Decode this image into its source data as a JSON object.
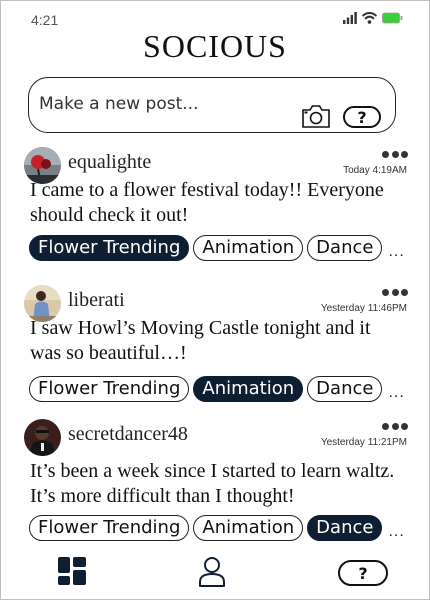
{
  "status_bar": {
    "time": "4:21"
  },
  "app": {
    "title": "SOCIOUS"
  },
  "composer": {
    "placeholder": "Make a new post...",
    "help_label": "?"
  },
  "posts": [
    {
      "username": "equalighte",
      "timestamp": "Today 4:19AM",
      "text": "I came to a flower festival today!! Everyone should check it out!",
      "tags": [
        "Flower Trending",
        "Animation",
        "Dance"
      ],
      "active_tag": "Flower Trending",
      "more": "..."
    },
    {
      "username": "liberati",
      "timestamp": "Yesterday 11:46PM",
      "text": "I saw Howl’s Moving Castle tonight and it was so beautiful…!",
      "tags": [
        "Flower Trending",
        "Animation",
        "Dance"
      ],
      "active_tag": "Animation",
      "more": "..."
    },
    {
      "username": "secretdancer48",
      "timestamp": "Yesterday 11:21PM",
      "text": "It’s been a week since I started to learn waltz. It’s more difficult than I thought!",
      "tags": [
        "Flower Trending",
        "Animation",
        "Dance"
      ],
      "active_tag": "Dance",
      "more": "..."
    }
  ],
  "bottom_nav": {
    "help_label": "?"
  },
  "colors": {
    "accent": "#0f1f33",
    "battery": "#3ccf3c"
  }
}
